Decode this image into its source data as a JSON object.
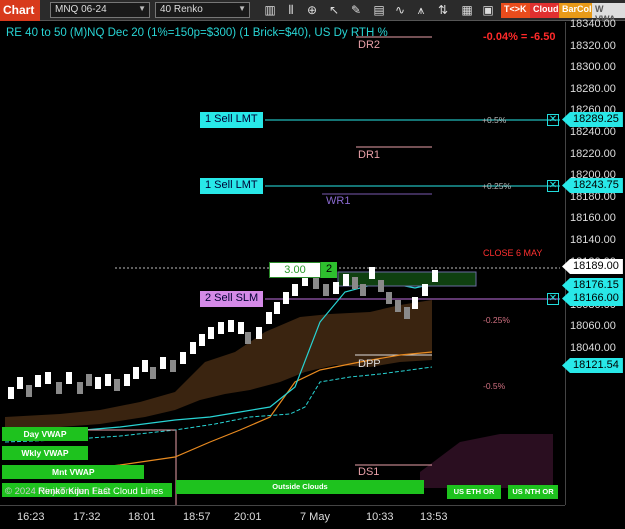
{
  "toolbar": {
    "chart_tab": "Chart",
    "instrument": "MNQ 06-24",
    "bar_type": "40 Renko",
    "btn_tck": "T<>K",
    "btn_cloud": "Cloud",
    "btn_barcol": "BarCol",
    "btn_vwva": "W VWA",
    "colors": {
      "tck": "#e84c1c",
      "cloud": "#e03030",
      "barcol": "#e89a18",
      "vwva": "#dddddd"
    }
  },
  "chart": {
    "title": "RE 40 to 50 (M)NQ Dec 20 (1%=150p=$300) (1 Brick=$40), US Dy RTH %",
    "pnl": "-0.04% = -6.50",
    "levels": {
      "dr2": "DR2",
      "dr1": "DR1",
      "wr1": "WR1",
      "close": "CLOSE 6 MAY",
      "dpp": "DPP",
      "ds1": "DS1"
    },
    "orders": [
      {
        "label": "1 Sell LMT",
        "pct": "+0.5%"
      },
      {
        "label": "1 Sell LMT",
        "pct": "+0.25%"
      },
      {
        "label": "2 Sell SLM",
        "pct": "-0.25%"
      }
    ],
    "pct_minus_half": "-0.5%",
    "position": {
      "qty": "3.00",
      "count": "2"
    },
    "y_ticks": [
      "18340.00",
      "18320.00",
      "18300.00",
      "18280.00",
      "18260.00",
      "18240.00",
      "18220.00",
      "18200.00",
      "18180.00",
      "18160.00",
      "18140.00",
      "18120.00",
      "18100.00",
      "18080.00",
      "18060.00",
      "18040.00"
    ],
    "x_ticks": [
      "16:23",
      "17:32",
      "18:01",
      "18:57",
      "20:01",
      "7 May",
      "10:33",
      "13:53"
    ],
    "price_tags": [
      {
        "value": "18289.25",
        "color": "#28e8e8"
      },
      {
        "value": "18243.75",
        "color": "#28e8e8"
      },
      {
        "value": "18189.00",
        "color": "#ffffff"
      },
      {
        "value": "18176.15",
        "color": "#28e8e8"
      },
      {
        "value": "18166.00",
        "color": "#28e8e8"
      },
      {
        "value": "18121.54",
        "color": "#28e8e8"
      }
    ],
    "vwap_boxes": [
      "Day VWAP",
      "Wkly VWAP",
      "Mnt VWAP"
    ],
    "outside_clouds": "Outside Clouds",
    "us_eth_or": "US ETH OR",
    "us_nth_or": "US NTH OR",
    "footer": "© 2024 NinjaTrader, LLC",
    "footer_overlay": "Renko Kijun Fast Cloud Lines"
  }
}
